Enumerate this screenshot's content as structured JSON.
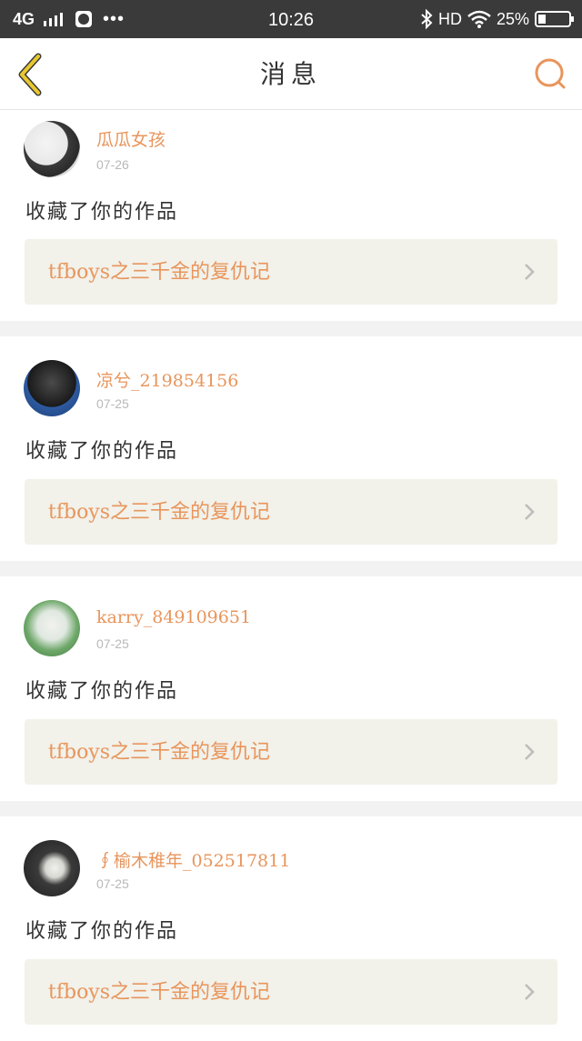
{
  "status_bar": {
    "network": "4G",
    "more": "•••",
    "time": "10:26",
    "hd": "HD",
    "battery": "25%",
    "battery_level": 0.25
  },
  "nav": {
    "title": "消息",
    "back_icon": "chevron-left-icon",
    "search_icon": "search-icon",
    "accent_color": "#e8955c",
    "back_color": "#e8c830"
  },
  "feed": [
    {
      "username": "瓜瓜女孩",
      "date": "07-26",
      "action": "收藏了你的作品",
      "work_title": "tfboys之三千金的复仇记"
    },
    {
      "username": "凉兮_219854156",
      "date": "07-25",
      "action": "收藏了你的作品",
      "work_title": "tfboys之三千金的复仇记"
    },
    {
      "username": "karry_849109651",
      "date": "07-25",
      "action": "收藏了你的作品",
      "work_title": "tfboys之三千金的复仇记"
    },
    {
      "username": "∮榆木稚年_052517811",
      "date": "07-25",
      "action": "收藏了你的作品",
      "work_title": "tfboys之三千金的复仇记"
    }
  ]
}
